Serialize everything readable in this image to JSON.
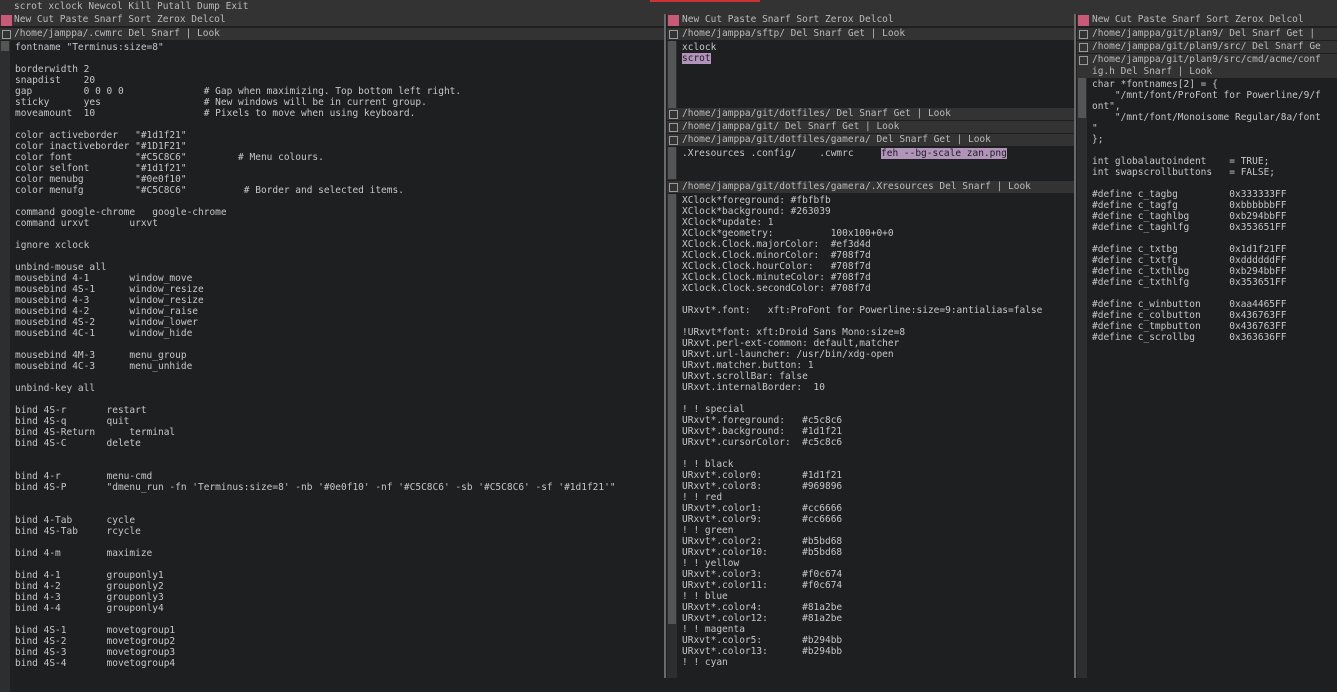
{
  "colors": {
    "bg": "#1d1f21",
    "tagbg": "#333333",
    "tagfg": "#bbbbbb",
    "highlight": "#b294bb",
    "mark": "#c85a78"
  },
  "topbar": {
    "label": "scrot xclock Newcol Kill Putall Dump Exit"
  },
  "col1": {
    "tag": "New Cut Paste Snarf Sort Zerox Delcol",
    "win_tag": "/home/jamppa/.cwmrc Del Snarf | Look",
    "lines": [
      "fontname \"Terminus:size=8\"",
      "",
      "borderwidth 2",
      "snapdist    20",
      "gap         0 0 0 0              # Gap when maximizing. Top bottom left right.",
      "sticky      yes                  # New windows will be in current group.",
      "moveamount  10                   # Pixels to move when using keyboard.",
      "",
      "color activeborder   \"#1d1f21\"",
      "color inactiveborder \"#1D1F21\"",
      "color font           \"#C5C8C6\"         # Menu colours.",
      "color selfont        \"#1d1f21\"",
      "color menubg         \"#0e0f10\"",
      "color menufg         \"#C5C8C6\"          # Border and selected items.",
      "",
      "command google-chrome   google-chrome",
      "command urxvt       urxvt",
      "",
      "ignore xclock",
      "",
      "unbind-mouse all",
      "mousebind 4-1       window_move",
      "mousebind 4S-1      window_resize",
      "mousebind 4-3       window_resize",
      "mousebind 4-2       window_raise",
      "mousebind 4S-2      window_lower",
      "mousebind 4C-1      window_hide",
      "",
      "mousebind 4M-3      menu_group",
      "mousebind 4C-3      menu_unhide",
      "",
      "unbind-key all",
      "",
      "bind 4S-r       restart",
      "bind 4S-q       quit",
      "bind 4S-Return      terminal",
      "bind 4S-C       delete",
      "",
      "",
      "bind 4-r        menu-cmd",
      "bind 4S-P       \"dmenu_run -fn 'Terminus:size=8' -nb '#0e0f10' -nf '#C5C8C6' -sb '#C5C8C6' -sf '#1d1f21'\"",
      "",
      "",
      "bind 4-Tab      cycle",
      "bind 4S-Tab     rcycle",
      "",
      "bind 4-m        maximize",
      "",
      "bind 4-1        grouponly1",
      "bind 4-2        grouponly2",
      "bind 4-3        grouponly3",
      "bind 4-4        grouponly4",
      "",
      "bind 4S-1       movetogroup1",
      "bind 4S-2       movetogroup2",
      "bind 4S-3       movetogroup3",
      "bind 4S-4       movetogroup4"
    ]
  },
  "col2": {
    "tag": "New Cut Paste Snarf Sort Zerox Delcol",
    "w1_tag": "/home/jamppa/sftp/ Del Snarf Get | Look",
    "w1_line1": "xclock",
    "w1_line2": "scrot",
    "w2_tag": "/home/jamppa/git/dotfiles/ Del Snarf Get | Look",
    "w3_tag": "/home/jamppa/git/ Del Snarf Get | Look",
    "w4_tag": "/home/jamppa/git/dotfiles/gamera/ Del Snarf Get | Look",
    "w4_files": ".Xresources .config/    .cwmrc",
    "w4_sel": "feh --bg-scale zan.png",
    "w5_tag": "/home/jamppa/git/dotfiles/gamera/.Xresources Del Snarf | Look",
    "w5_lines": [
      "XClock*foreground: #fbfbfb",
      "XClock*background: #263039",
      "XClock*update: 1",
      "XClock*geometry:          100x100+0+0",
      "XClock.Clock.majorColor:  #ef3d4d",
      "XClock.Clock.minorColor:  #708f7d",
      "XClock.Clock.hourColor:   #708f7d",
      "XClock.Clock.minuteColor: #708f7d",
      "XClock.Clock.secondColor: #708f7d",
      "",
      "URxvt*.font:   xft:ProFont for Powerline:size=9:antialias=false",
      "",
      "!URxvt*font: xft:Droid Sans Mono:size=8",
      "URxvt.perl-ext-common: default,matcher",
      "URxvt.url-launcher: /usr/bin/xdg-open",
      "URxvt.matcher.button: 1",
      "URxvt.scrollBar: false",
      "URxvt.internalBorder:  10",
      "",
      "! ! special",
      "URxvt*.foreground:   #c5c8c6",
      "URxvt*.background:   #1d1f21",
      "URxvt*.cursorColor:  #c5c8c6",
      "",
      "! ! black",
      "URxvt*.color0:       #1d1f21",
      "URxvt*.color8:       #969896",
      "! ! red",
      "URxvt*.color1:       #cc6666",
      "URxvt*.color9:       #cc6666",
      "! ! green",
      "URxvt*.color2:       #b5bd68",
      "URxvt*.color10:      #b5bd68",
      "! ! yellow",
      "URxvt*.color3:       #f0c674",
      "URxvt*.color11:      #f0c674",
      "! ! blue",
      "URxvt*.color4:       #81a2be",
      "URxvt*.color12:      #81a2be",
      "! ! magenta",
      "URxvt*.color5:       #b294bb",
      "URxvt*.color13:      #b294bb",
      "! ! cyan"
    ]
  },
  "col3": {
    "tag": "New Cut Paste Snarf Sort Zerox Delcol",
    "w1_tag": "/home/jamppa/git/plan9/ Del Snarf Get |",
    "w2_tag": "/home/jamppa/git/plan9/src/ Del Snarf Ge",
    "w3_tag1": "/home/jamppa/git/plan9/src/cmd/acme/conf",
    "w3_tag2": "ig.h Del Snarf | Look",
    "w3_lines": [
      "char *fontnames[2] = {",
      "    \"/mnt/font/ProFont for Powerline/9/f",
      "ont\",",
      "    \"/mnt/font/Monoisome Regular/8a/font",
      "\"",
      "};",
      "",
      "int globalautoindent    = TRUE;",
      "int swapscrollbuttons   = FALSE;",
      "",
      "#define c_tagbg         0x333333FF",
      "#define c_tagfg         0xbbbbbbFF",
      "#define c_taghlbg       0xb294bbFF",
      "#define c_taghlfg       0x353651FF",
      "",
      "#define c_txtbg         0x1d1f21FF",
      "#define c_txtfg         0xddddddFF",
      "#define c_txthlbg       0xb294bbFF",
      "#define c_txthlfg       0x353651FF",
      "",
      "#define c_winbutton     0xaa4465FF",
      "#define c_colbutton     0x436763FF",
      "#define c_tmpbutton     0x436763FF",
      "#define c_scrollbg      0x363636FF"
    ]
  }
}
